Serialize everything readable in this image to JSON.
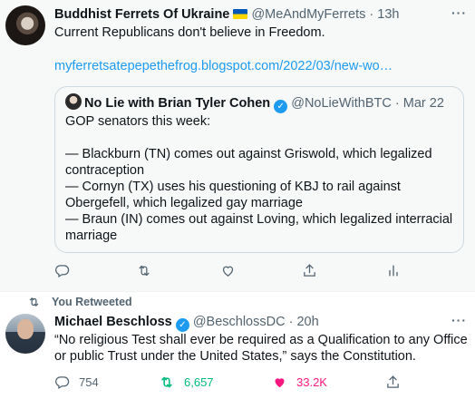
{
  "tweet1": {
    "author_name": "Buddhist Ferrets Of Ukraine",
    "handle": "@MeAndMyFerrets",
    "separator": "·",
    "time": "13h",
    "text": "Current Republicans don't believe in Freedom.",
    "link": "myferretsatepepethefrog.blogspot.com/2022/03/new-wo…",
    "quote": {
      "author_name": "No Lie with Brian Tyler Cohen",
      "handle": "@NoLieWithBTC",
      "separator": "·",
      "date": "Mar 22",
      "lines": [
        "GOP senators this week:",
        "— Blackburn (TN) comes out against Griswold, which legalized contraception",
        "— Cornyn (TX) uses his questioning of KBJ to rail against Obergefell, which legalized gay marriage",
        "— Braun (IN) comes out against Loving, which legalized interracial marriage"
      ]
    }
  },
  "tweet2": {
    "retweet_label": "You Retweeted",
    "author_name": "Michael Beschloss",
    "handle": "@BeschlossDC",
    "separator": "·",
    "time": "20h",
    "text": "“No religious Test shall ever be required as a Qualification to any Office or public Trust under the United States,” says the Constitution.",
    "replies": "754",
    "retweets": "6,657",
    "likes": "33.2K"
  },
  "colors": {
    "accent": "#1d9bf0",
    "retweet_green": "#00ba7c",
    "like_pink": "#f91880",
    "muted": "#536471"
  },
  "icons": [
    "reply-icon",
    "retweet-icon",
    "like-icon",
    "share-icon",
    "analytics-icon",
    "more-icon",
    "verified-badge-icon",
    "ukraine-flag-icon"
  ]
}
